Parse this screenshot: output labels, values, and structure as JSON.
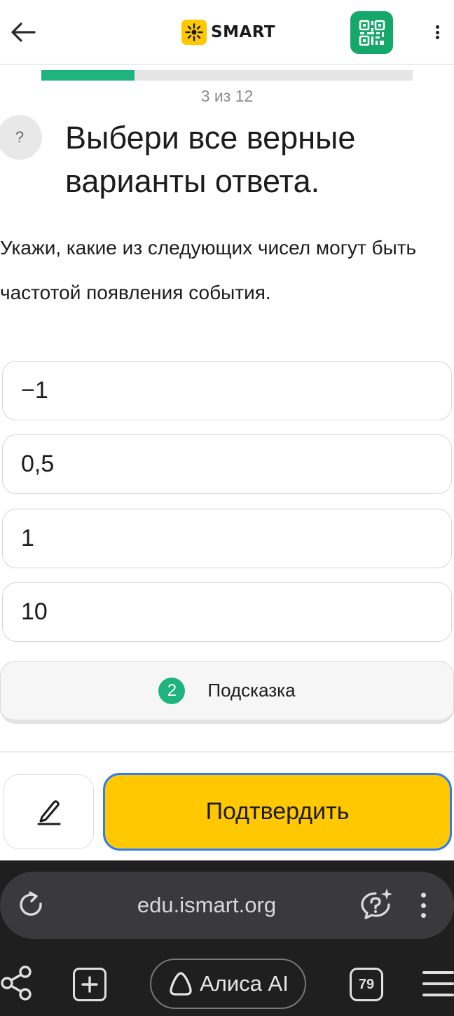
{
  "header": {
    "back_icon": "arrow-left-icon",
    "logo_text": "SMART",
    "logo_color": "#ffc800",
    "qr_icon": "qr-code-icon",
    "qr_color": "#15a86a",
    "more_icon": "kebab-menu-icon"
  },
  "progress": {
    "current": 3,
    "total": 12,
    "label": "3 из 12",
    "fill_color": "#1fb37f"
  },
  "question": {
    "help_symbol": "?",
    "title": "Выбери все верные варианты ответа.",
    "prompt": "Укажи, какие из следующих чисел могут быть частотой появления события."
  },
  "options": [
    "−1",
    "0,5",
    "1",
    "10"
  ],
  "hint": {
    "count": "2",
    "label": "Подсказка"
  },
  "actions": {
    "draft_icon": "pencil-icon",
    "confirm_label": "Подтвердить",
    "confirm_color": "#ffc800"
  },
  "browser": {
    "reload_icon": "reload-icon",
    "url": "edu.ismart.org",
    "ai_icon": "ai-chat-icon",
    "more_icon": "kebab-menu-icon",
    "share_icon": "share-icon",
    "new_tab_icon": "plus-square-icon",
    "alice_label": "Алиса AI",
    "tabs_count": "79",
    "menu_icon": "hamburger-icon"
  }
}
